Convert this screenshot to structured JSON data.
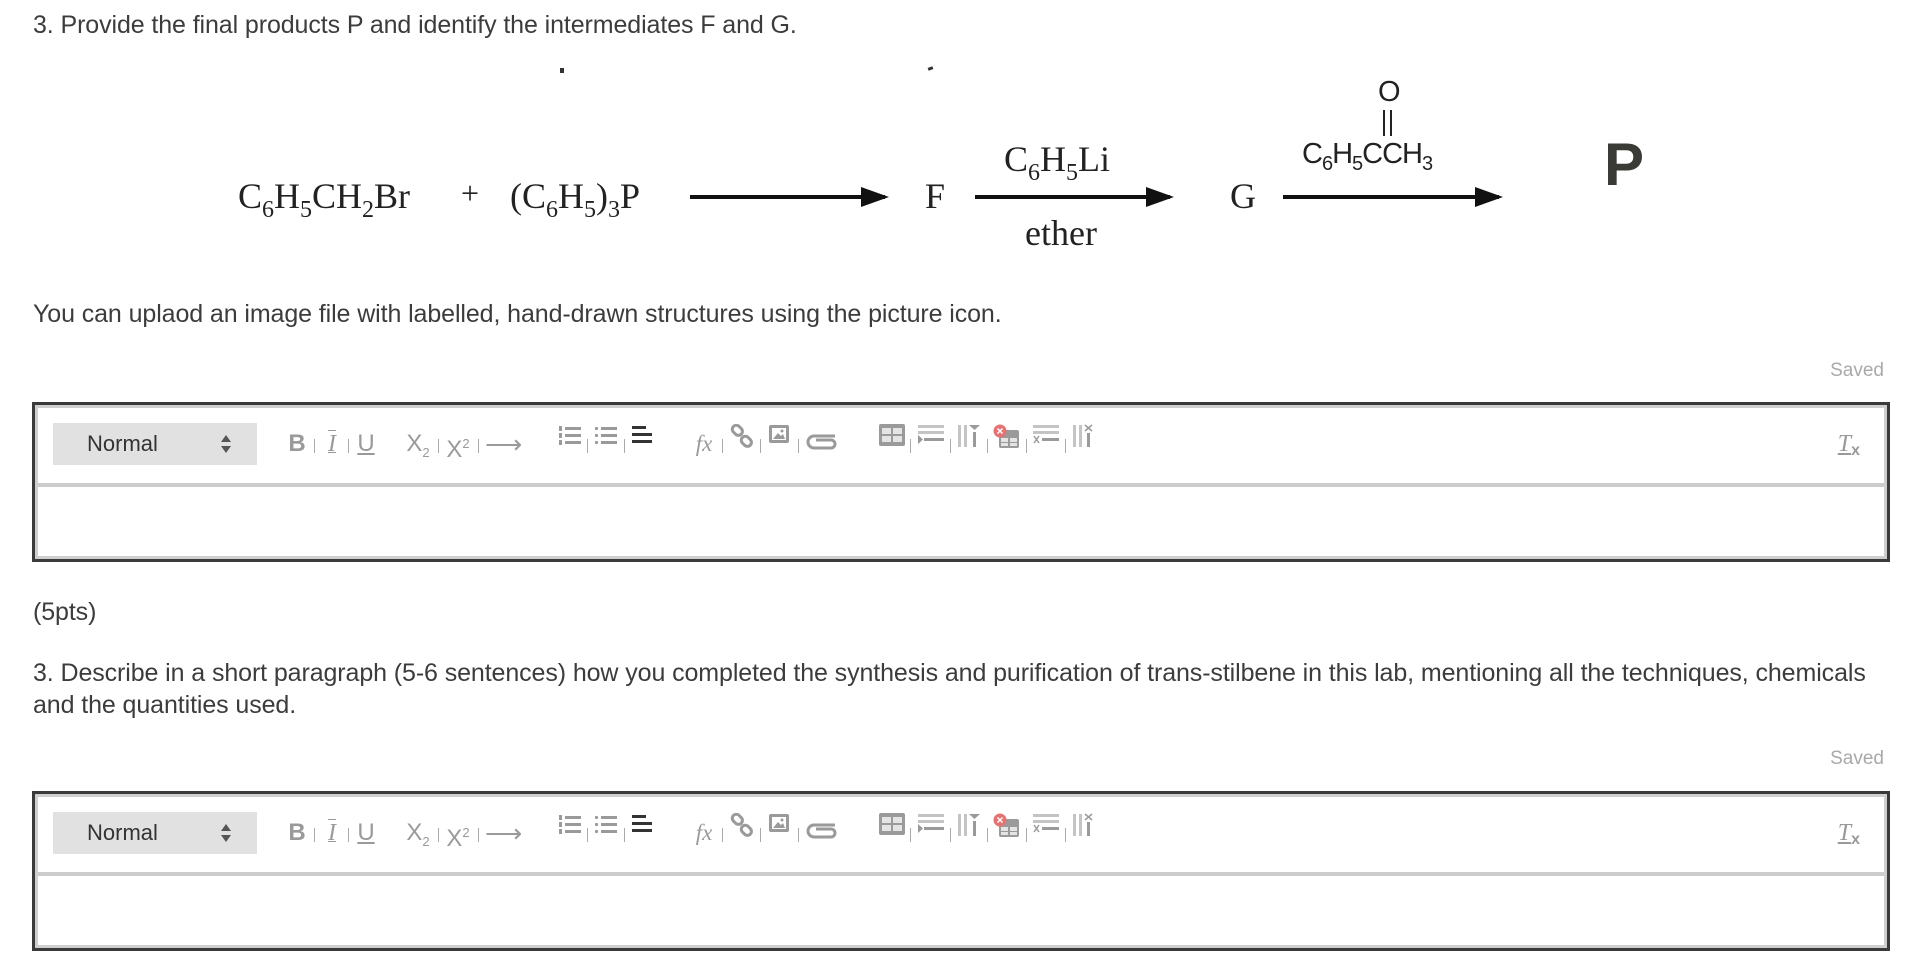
{
  "question1": {
    "title": "3. Provide the final products P and identify the intermediates F and G.",
    "note": "You can uplaod an image file with labelled, hand-drawn structures using the picture icon.",
    "saved_status": "Saved",
    "scheme": {
      "reactant1": {
        "parts": [
          "C",
          "6",
          "H",
          "5",
          "CH",
          "2",
          "Br"
        ]
      },
      "plus": "+",
      "reactant2": {
        "parts": [
          "(C",
          "6",
          "H",
          "5",
          ")",
          "3",
          "P"
        ]
      },
      "intermediate_F": "F",
      "reagent2_top": {
        "parts": [
          "C",
          "6",
          "H",
          "5",
          "Li"
        ]
      },
      "reagent2_bottom": "ether",
      "intermediate_G": "G",
      "reagent3_oxygen": "O",
      "reagent3": {
        "parts": [
          "C",
          "6",
          "H",
          "5",
          "CCH",
          "3"
        ]
      },
      "product": "P"
    }
  },
  "points": "(5pts)",
  "question2": {
    "title": "3. Describe in a short paragraph (5-6 sentences) how you completed the synthesis and purification of trans-stilbene in this lab, mentioning all the techniques, chemicals and the quantities used.",
    "saved_status": "Saved"
  },
  "editor": {
    "format_select": "Normal",
    "buttons": {
      "bold": "B",
      "italic": "I",
      "underline": "U",
      "subscript": "X",
      "subscript_mark": "2",
      "superscript": "X",
      "superscript_mark": "2",
      "arrow": "⟶",
      "formula": "fx",
      "clear_format": "T",
      "clear_format_mark": "x"
    },
    "accent_colors": {
      "toolbar_icon": "#9a9a9a",
      "delete_table_badge": "#e57373",
      "select_bg": "#e1e1e1"
    }
  }
}
